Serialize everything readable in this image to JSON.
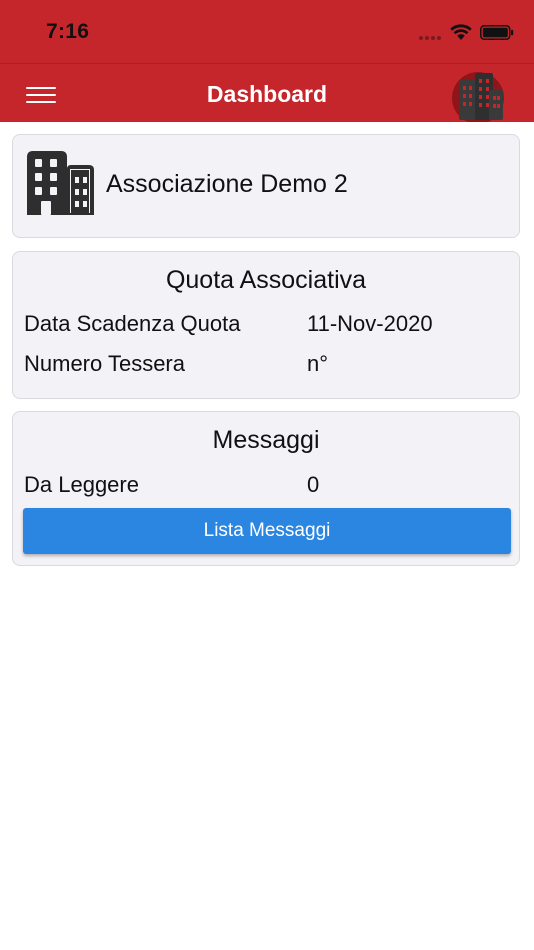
{
  "status_bar": {
    "time": "7:16"
  },
  "header": {
    "title": "Dashboard",
    "menu_icon": "hamburger-menu-icon",
    "logo_icon": "buildings-logo-icon",
    "background_color": "#c4262c"
  },
  "association_card": {
    "icon": "buildings-icon",
    "name": "Associazione Demo 2"
  },
  "quota_card": {
    "title": "Quota Associativa",
    "rows": [
      {
        "label": "Data Scadenza Quota",
        "value": "11-Nov-2020"
      },
      {
        "label": "Numero Tessera",
        "value": "n°"
      }
    ]
  },
  "messages_card": {
    "title": "Messaggi",
    "unread_label": "Da Leggere",
    "unread_count": "0",
    "list_button_label": "Lista Messaggi",
    "button_color": "#2a86e0"
  }
}
